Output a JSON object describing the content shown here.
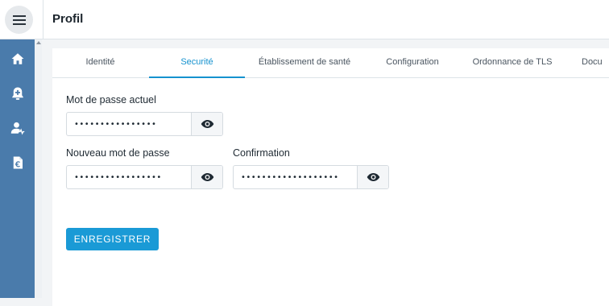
{
  "header": {
    "title": "Profil",
    "menu_icon": "hamburger-icon"
  },
  "sidebar": {
    "color": "#4a7bab",
    "items": [
      {
        "icon": "home-icon"
      },
      {
        "icon": "medical-alert-icon"
      },
      {
        "icon": "patient-icon"
      },
      {
        "icon": "euro-document-icon"
      }
    ]
  },
  "tabs": [
    {
      "label": "Identité",
      "active": false
    },
    {
      "label": "Securité",
      "active": true
    },
    {
      "label": "Établissement de santé",
      "active": false
    },
    {
      "label": "Configuration",
      "active": false
    },
    {
      "label": "Ordonnance de TLS",
      "active": false
    },
    {
      "label": "Docu",
      "active": false
    }
  ],
  "form": {
    "current_password": {
      "label": "Mot de passe actuel",
      "value": "••••••••••••••••"
    },
    "new_password": {
      "label": "Nouveau mot de passe",
      "value": "•••••••••••••••••"
    },
    "confirmation": {
      "label": "Confirmation",
      "value": "•••••••••••••••••••"
    },
    "toggle_icon": "eye-icon"
  },
  "actions": {
    "save_label": "ENREGISTRER"
  },
  "colors": {
    "accent": "#1592cf",
    "button": "#1a9ad6"
  }
}
